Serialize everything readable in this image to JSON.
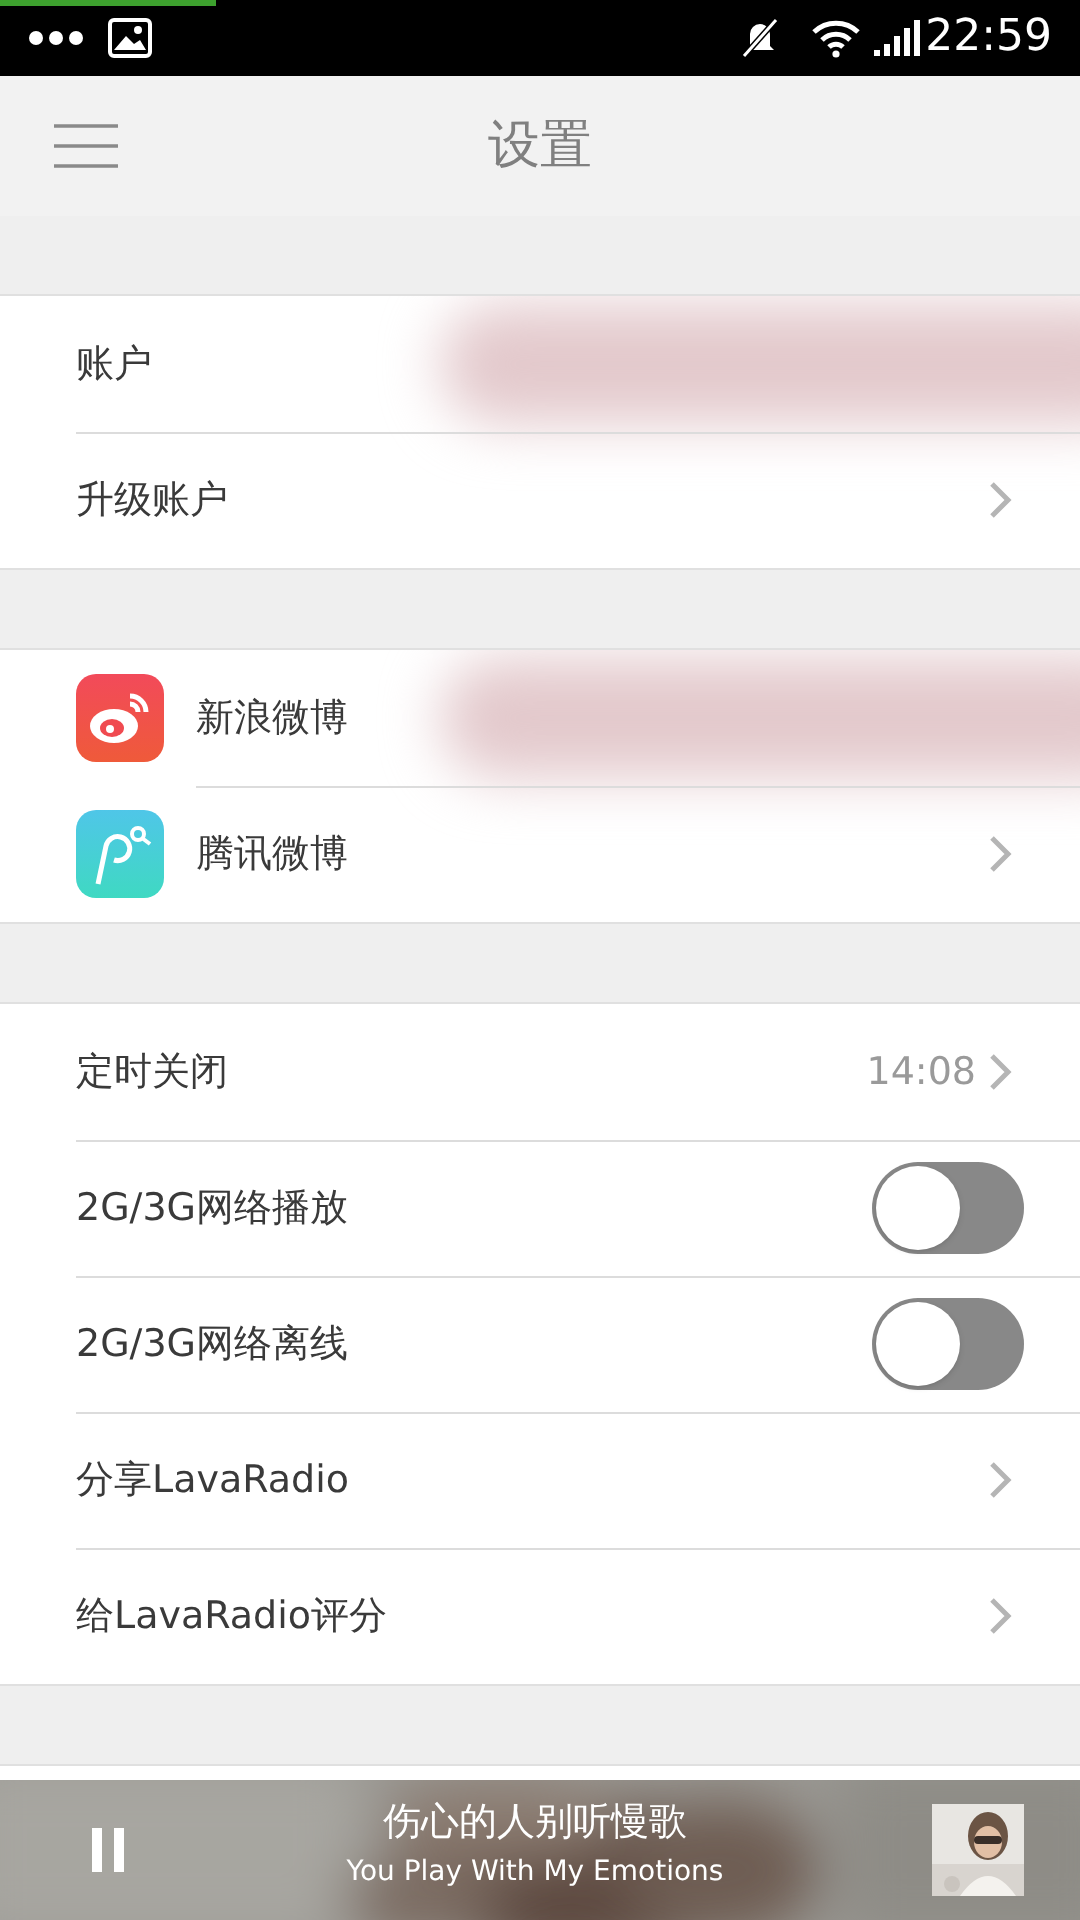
{
  "status_bar": {
    "time": "22:59"
  },
  "header": {
    "title": "设置"
  },
  "groups": [
    {
      "rows": [
        {
          "kind": "plain",
          "label": "账户"
        },
        {
          "kind": "chevron",
          "label": "升级账户"
        }
      ]
    },
    {
      "rows": [
        {
          "kind": "plain",
          "label": "新浪微博"
        },
        {
          "kind": "chevron",
          "label": "腾讯微博"
        }
      ]
    },
    {
      "rows": [
        {
          "kind": "value",
          "label": "定时关闭",
          "value": "14:08"
        },
        {
          "kind": "toggle",
          "label": "2G/3G网络播放",
          "on": false
        },
        {
          "kind": "toggle",
          "label": "2G/3G网络离线",
          "on": false
        },
        {
          "kind": "chevron",
          "label": "分享LavaRadio"
        },
        {
          "kind": "chevron",
          "label": "给LavaRadio评分"
        }
      ]
    }
  ],
  "player": {
    "title": "伤心的人别听慢歌",
    "subtitle": "You Play With My Emotions"
  }
}
